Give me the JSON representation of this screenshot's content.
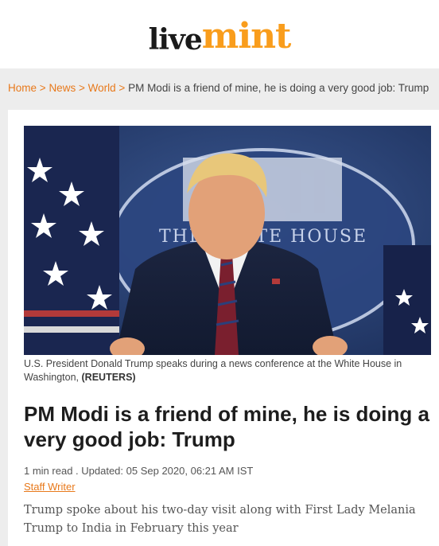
{
  "header": {
    "logo_live": "live",
    "logo_mint": "mint",
    "brand_color": "#f99d1c"
  },
  "breadcrumb": {
    "home": "Home",
    "news": "News",
    "world": "World",
    "separator": ">",
    "current": "PM Modi is a friend of mine, he is doing a very good job: Trump"
  },
  "article": {
    "image_caption": "U.S. President Donald Trump speaks during a news conference at the White House in Washington,",
    "image_credit": "(REUTERS)",
    "podium_text": "THE WHITE HOUSE",
    "headline": "PM Modi is a friend of mine, he is doing a very good job: Trump",
    "meta": "1 min read . Updated: 05 Sep 2020, 06:21 AM IST",
    "author": "Staff Writer",
    "summary": "Trump spoke about his two-day visit along with First Lady Melania Trump to India in February this year"
  },
  "colors": {
    "link": "#e8791b",
    "page_bg": "#ededed"
  }
}
